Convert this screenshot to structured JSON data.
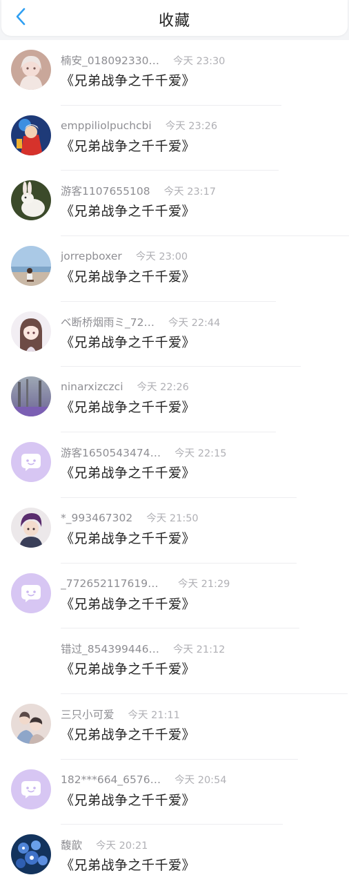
{
  "header": {
    "title": "收藏"
  },
  "colors": {
    "accent": "#2f9ff2",
    "default_avatar": "#d7c6f3"
  },
  "items": [
    {
      "user": "楠安_018092330…",
      "time": "今天 23:30",
      "work": "《兄弟战争之千千爱》",
      "avatar_icon": "girl-avatar-icon"
    },
    {
      "user": "emppiliolpuchcbi",
      "time": "今天 23:26",
      "work": "《兄弟战争之千千爱》",
      "avatar_icon": "hero-avatar-icon"
    },
    {
      "user": "游客1107655108",
      "time": "今天 23:17",
      "work": "《兄弟战争之千千爱》",
      "avatar_icon": "rabbit-avatar-icon"
    },
    {
      "user": "jorrepboxer",
      "time": "今天 23:00",
      "work": "《兄弟战争之千千爱》",
      "avatar_icon": "beach-avatar-icon"
    },
    {
      "user": "ベ断桥烟雨ミ_72…",
      "time": "今天 22:44",
      "work": "《兄弟战争之千千爱》",
      "avatar_icon": "anime-girl-avatar-icon"
    },
    {
      "user": "ninarxizczci",
      "time": "今天 22:26",
      "work": "《兄弟战争之千千爱》",
      "avatar_icon": "forest-avatar-icon"
    },
    {
      "user": "游客1650543474…",
      "time": "今天 22:15",
      "work": "《兄弟战争之千千爱》",
      "avatar_icon": "default-chat-avatar-icon"
    },
    {
      "user": "*_993467302",
      "time": "今天 21:50",
      "work": "《兄弟战争之千千爱》",
      "avatar_icon": "boy-avatar-icon"
    },
    {
      "user": "_7726521176194…",
      "time": "今天 21:29",
      "work": "《兄弟战争之千千爱》",
      "avatar_icon": "default-chat-avatar-icon"
    },
    {
      "user": "错过_854399446…",
      "time": "今天 21:12",
      "work": "《兄弟战争之千千爱》",
      "avatar_icon": "none"
    },
    {
      "user": "三只小可爱",
      "time": "今天 21:11",
      "work": "《兄弟战争之千千爱》",
      "avatar_icon": "group-avatar-icon"
    },
    {
      "user": "182***664_6576…",
      "time": "今天 20:54",
      "work": "《兄弟战争之千千爱》",
      "avatar_icon": "default-chat-avatar-icon"
    },
    {
      "user": "馥歆",
      "time": "今天 20:21",
      "work": "《兄弟战争之千千爱》",
      "avatar_icon": "blue-flower-avatar-icon"
    }
  ]
}
